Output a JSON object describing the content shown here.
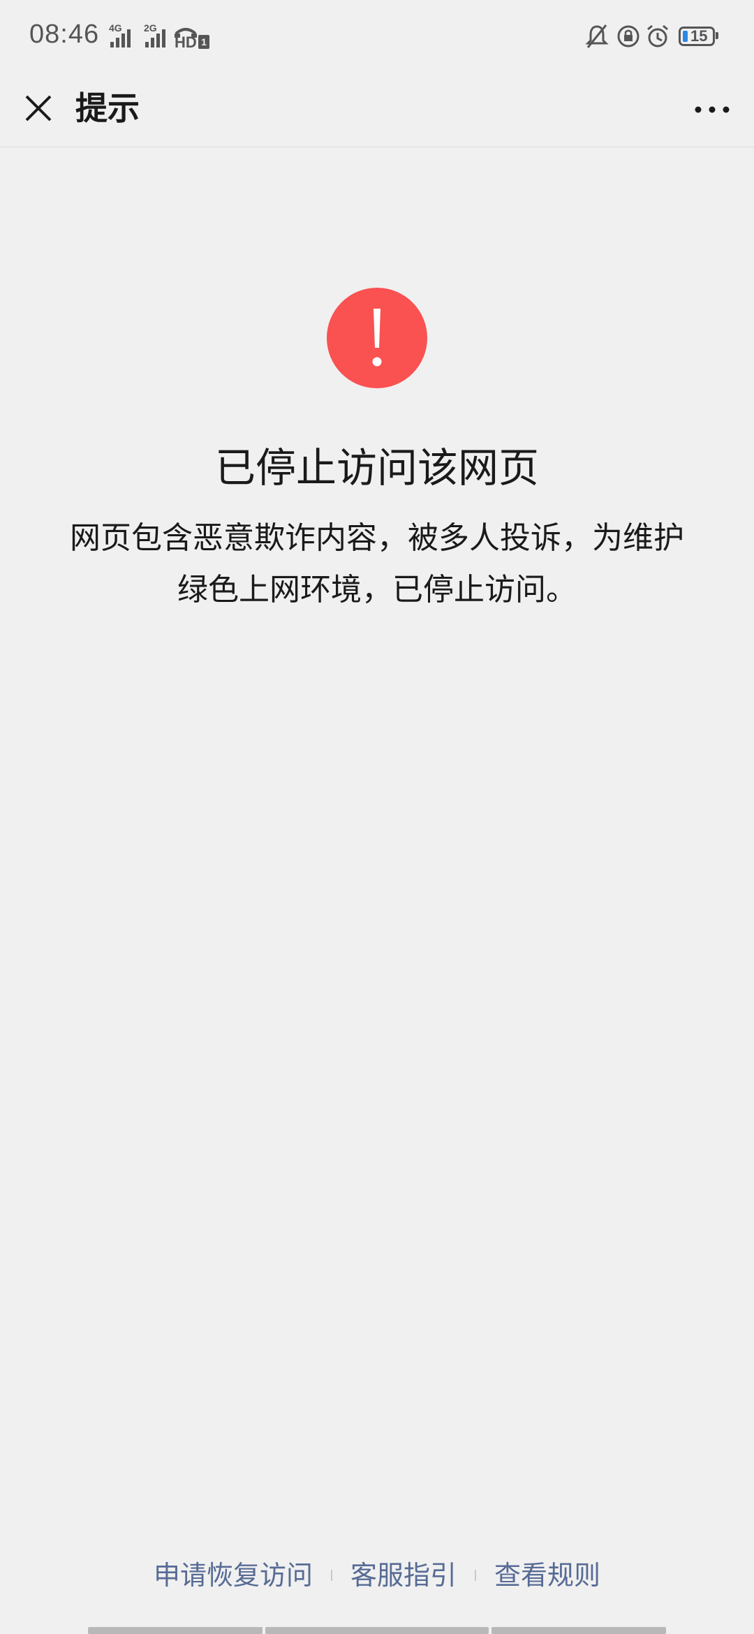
{
  "status_bar": {
    "time": "08:46",
    "signal1_label": "4G",
    "signal2_label": "2G",
    "hd_label": "HD",
    "hd_sub": "1",
    "battery_level": "15",
    "icons": [
      "signal-icon",
      "hd-call-icon",
      "mute-bell-icon",
      "rotation-lock-icon",
      "alarm-icon",
      "battery-icon"
    ]
  },
  "nav": {
    "title": "提示",
    "close_icon": "close-icon",
    "more_icon": "more-icon"
  },
  "warning": {
    "icon": "exclamation-icon",
    "color": "#fa5151",
    "title": "已停止访问该网页",
    "description_line1": "网页包含恶意欺诈内容，被多人投诉，为维护",
    "description_line2": "绿色上网环境，已停止访问。"
  },
  "footer": {
    "links": [
      "申请恢复访问",
      "客服指引",
      "查看规则"
    ],
    "link_color": "#576b95"
  }
}
